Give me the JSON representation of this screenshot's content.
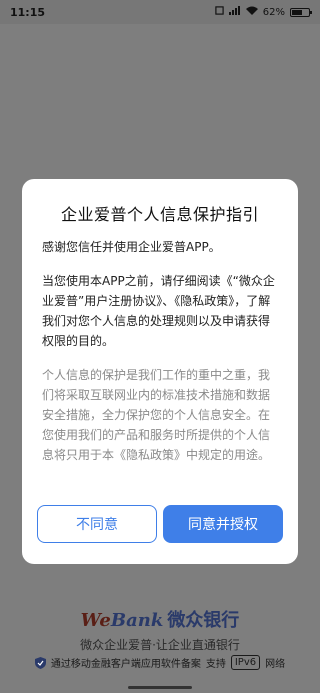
{
  "status_bar": {
    "time": "11:15",
    "battery_text": "62%",
    "battery_level": 0.62
  },
  "dialog": {
    "title": "企业爱普个人信息保护指引",
    "para1": "感谢您信任并使用企业爱普APP。",
    "para2": "当您使用本APP之前，请仔细阅读《“微众企业爱普”用户注册协议》、《隐私政策》，了解我们对您个人信息的处理规则以及申请获得权限的目的。",
    "para3": "个人信息的保护是我们工作的重中之重，我们将采取互联网业内的标准技术措施和数据安全措施，全力保护您的个人信息安全。在您使用我们的产品和服务时所提供的个人信息将只用于本《隐私政策》中规定的用途。",
    "decline_label": "不同意",
    "accept_label": "同意并授权"
  },
  "brand": {
    "logo_we": "We",
    "logo_bank": "Bank",
    "logo_cn": "微众银行",
    "slogan": "微众企业爱普·让企业直通银行"
  },
  "footer": {
    "filing_text": "通过移动金融客户端应用软件备案",
    "support_text": "支持",
    "ipv6_text": "IPv6",
    "network_text": "网络"
  },
  "colors": {
    "accent": "#3f7fe8",
    "overlay": "#7e7e7e"
  }
}
